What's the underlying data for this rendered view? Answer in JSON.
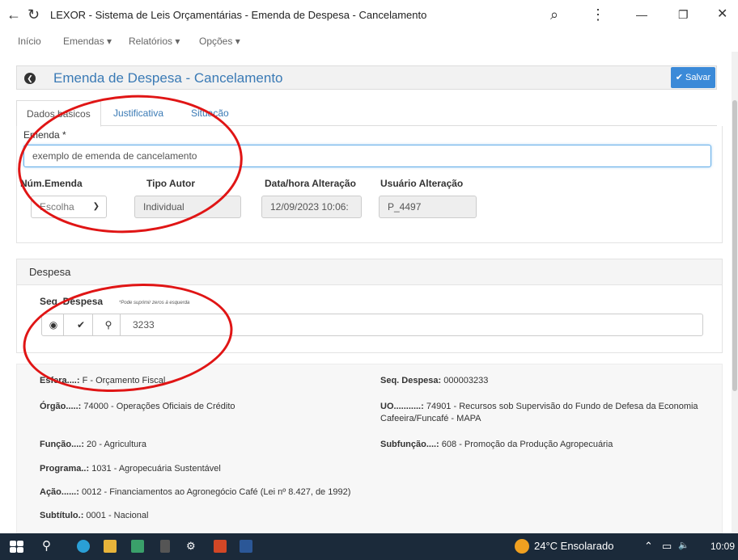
{
  "window": {
    "title": "LEXOR - Sistema de Leis Orçamentárias - Emenda de Despesa - Cancelamento",
    "back_glyph": "←",
    "reload_glyph": "↻",
    "zoom_glyph": "⌕",
    "menu_glyph": "⋮",
    "minimize_glyph": "—",
    "restore_glyph": "❐",
    "close_glyph": "✕"
  },
  "menu": {
    "inicio": "Início",
    "emendas": "Emendas ▾",
    "relatorios": "Relatórios ▾",
    "opcoes": "Opções ▾"
  },
  "page": {
    "title": "Emenda de Despesa - Cancelamento",
    "save": "✔ Salvar"
  },
  "tabs": {
    "dados": "Dados básicos",
    "justificativa": "Justificativa",
    "situacao": "Situação"
  },
  "form": {
    "emenda_label": "Emenda *",
    "emenda_value": "exemplo de emenda de cancelamento",
    "num_emenda_label": "Núm.Emenda",
    "num_emenda_value": "Escolha",
    "tipo_autor_label": "Tipo Autor",
    "tipo_autor_value": "Individual",
    "data_hora_label": "Data/hora Alteração",
    "data_hora_value": "12/09/2023 10:06:",
    "usuario_label": "Usuário Alteração",
    "usuario_value": "P_4497"
  },
  "despesa": {
    "header": "Despesa",
    "seq_label": "Seq. Despesa",
    "seq_hint": "*Pode suprimir zeros à esquerda",
    "seq_value": "3233"
  },
  "info": {
    "esfera_k": "Esfera....:",
    "esfera_v": " F - Orçamento Fiscal",
    "seq_k": "Seq. Despesa:",
    "seq_v": " 000003233",
    "orgao_k": "Órgão.....:",
    "orgao_v": " 74000 - Operações Oficiais de Crédito",
    "uo_k": "UO...........:",
    "uo_v": " 74901 - Recursos sob Supervisão do Fundo de Defesa da Economia Cafeeira/Funcafé - MAPA",
    "funcao_k": "Função....:",
    "funcao_v": " 20 - Agricultura",
    "subfuncao_k": "Subfunção....:",
    "subfuncao_v": " 608 - Promoção da Produção Agropecuária",
    "programa_k": "Programa..:",
    "programa_v": " 1031 - Agropecuária Sustentável",
    "acao_k": "Ação......:",
    "acao_v": " 0012 - Financiamentos ao Agronegócio Café (Lei nº 8.427, de 1992)",
    "subtitulo_k": "Subtítulo.:",
    "subtitulo_v": " 0001 - Nacional"
  },
  "taskbar": {
    "weather": "24°C  Ensolarado",
    "time": "10:09"
  },
  "colors": {
    "accent": "#3a7ab5",
    "save_button": "#3b8ad8",
    "annotation": "#e01515",
    "taskbar": "#1b2a3a"
  }
}
